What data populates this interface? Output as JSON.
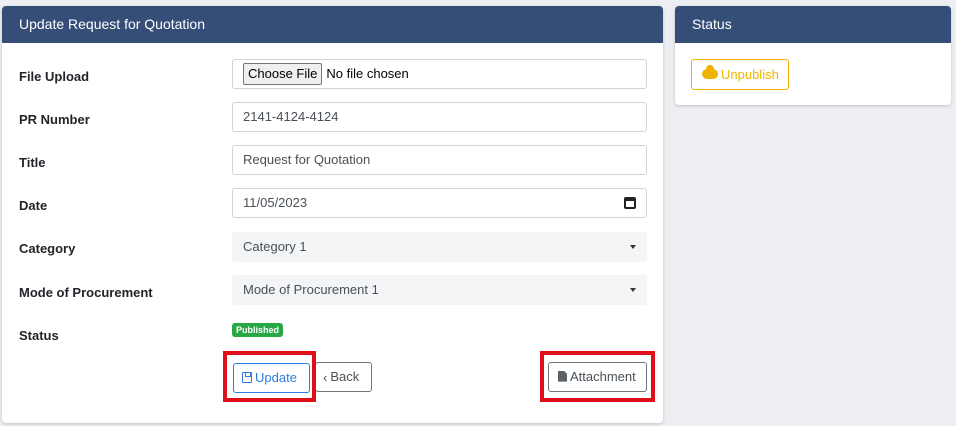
{
  "main": {
    "title": "Update Request for Quotation",
    "fields": {
      "file_upload": {
        "label": "File Upload",
        "button": "Choose File",
        "value": "No file chosen"
      },
      "pr_number": {
        "label": "PR Number",
        "value": "2141-4124-4124"
      },
      "title": {
        "label": "Title",
        "value": "Request for Quotation"
      },
      "date": {
        "label": "Date",
        "value": "11/05/2023"
      },
      "category": {
        "label": "Category",
        "value": "Category 1"
      },
      "mode": {
        "label": "Mode of Procurement",
        "value": "Mode of Procurement 1"
      },
      "status": {
        "label": "Status",
        "badge": "Published"
      }
    },
    "buttons": {
      "update": "Update",
      "back": "Back",
      "attachment": "Attachment"
    }
  },
  "status_panel": {
    "title": "Status",
    "unpublish": "Unpublish"
  },
  "colors": {
    "header": "#354e78",
    "primary": "#2f7de1",
    "warning": "#f0b400",
    "success": "#28a745",
    "highlight": "#e0101a"
  },
  "icons": [
    "save-icon",
    "chevron-left-icon",
    "file-icon",
    "calendar-icon",
    "cloud-icon",
    "caret-down-icon"
  ]
}
